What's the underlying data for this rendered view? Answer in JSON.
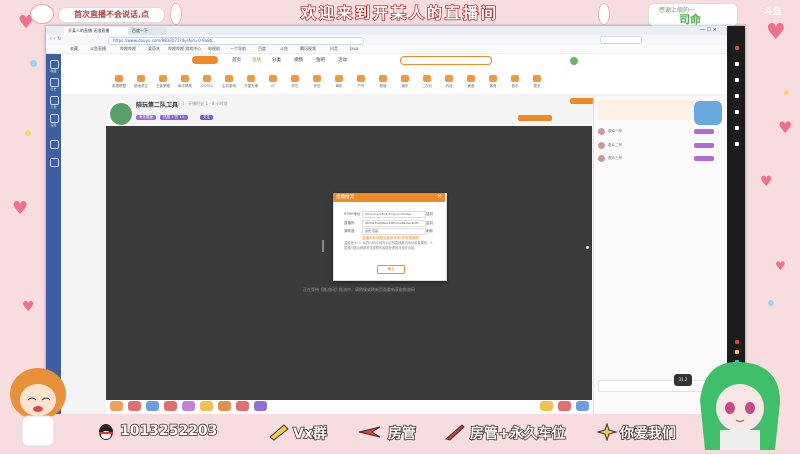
{
  "overlay": {
    "top_title": "欢迎来到开某人的直播间",
    "top_left_bubble": "首次直播不会说话,点",
    "top_right_card": {
      "label": "感谢上舰的一",
      "name": "司命"
    },
    "watermark": "斗鱼",
    "bottom": {
      "qq": "1013252203",
      "vx": "Vx群",
      "fangguan": "房管",
      "fangguan_seat": "房管+永久车位",
      "love": "你爱我们"
    }
  },
  "browser": {
    "tabs": [
      "开某人的直播 无限直播",
      "百度一下"
    ],
    "url": "https://www.douyu.com/9833271?dyshid=0-9a8b...",
    "bookmarks": [
      "收藏",
      "斗鱼直播",
      "哔哩哔哩",
      "爱奇艺",
      "哔哩哔哩 游戏中心",
      "电视剧",
      "一个导航",
      "百度",
      "斗鱼",
      "腾讯视频",
      "抖音",
      "Java"
    ]
  },
  "sidebar": {
    "labels": [
      "收藏",
      "历史",
      "下载",
      "设置"
    ]
  },
  "site": {
    "nav": [
      "首页",
      "直播",
      "分类",
      "视频",
      "鱼吧",
      "活动",
      "赛事"
    ],
    "categories": [
      "英雄联盟",
      "绝地求生",
      "王者荣耀",
      "和平精英",
      "DOTA2",
      "主机游戏",
      "守望先锋",
      "CF",
      "炉石",
      "怀旧",
      "单机",
      "户外",
      "颜值",
      "娱乐",
      "二次元",
      "科技",
      "美食",
      "体育",
      "音乐",
      "更多"
    ]
  },
  "room": {
    "title": "陪玩第二队工具",
    "meta": "· 房间号 1 · 开播时长 1 · 8 小时前",
    "tags": [
      "有无限度",
      "热度 1 赞 1人",
      "关注"
    ],
    "caption": "正在等待【推流码】推流中，请稍候或刷新页面重新获取推流码"
  },
  "dialog": {
    "title": "直播推流",
    "fields": [
      {
        "label": "RTMP地址",
        "value": "rtmp://sendtc3.douyu.com/live",
        "side": "复制"
      },
      {
        "label": "直播码",
        "value": "983327tsjMNnc4WfmhwNkqwxkhXt...",
        "side": "复制"
      },
      {
        "label": "清晰度",
        "value": "蓝光 原画",
        "side": "刷新"
      }
    ],
    "help": "直播码有效期及使用说明  获取直播码",
    "tips": "温馨提示: 1. 请在OBS中填写对应的直播推流地址和直播码。2. 如遇问题请刷新重试或联系客服处理推流相关问题。",
    "ok_label": "确定"
  },
  "right_panel": {
    "rows": [
      "观众一号",
      "观众二号",
      "观众三号"
    ]
  },
  "camera_badge": "31.2"
}
